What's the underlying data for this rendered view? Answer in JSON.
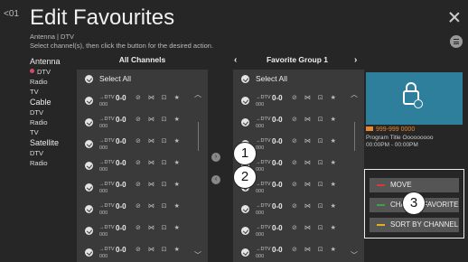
{
  "header": {
    "back_label": "<01",
    "title": "Edit Favourites",
    "breadcrumb": "Antenna | DTV",
    "instruction": "Select channel(s), then click the button for the desired action."
  },
  "sidebar": {
    "groups": [
      {
        "label": "Antenna",
        "items": [
          "DTV",
          "Radio",
          "TV"
        ]
      },
      {
        "label": "Cable",
        "items": [
          "DTV",
          "Radio",
          "TV"
        ]
      },
      {
        "label": "Satellite",
        "items": [
          "DTV",
          "Radio"
        ]
      }
    ]
  },
  "all_channels": {
    "header": "All Channels",
    "select_all": "Select All",
    "rows": [
      {
        "type": "DTV",
        "number": "0-0",
        "name": "000"
      },
      {
        "type": "DTV",
        "number": "0-0",
        "name": "000"
      },
      {
        "type": "DTV",
        "number": "0-0",
        "name": "000"
      },
      {
        "type": "DTV",
        "number": "0-0",
        "name": "000"
      },
      {
        "type": "DTV",
        "number": "0-0",
        "name": "000"
      },
      {
        "type": "DTV",
        "number": "0-0",
        "name": "000"
      },
      {
        "type": "DTV",
        "number": "0-0",
        "name": "000"
      },
      {
        "type": "DTV",
        "number": "0-0",
        "name": "000"
      }
    ]
  },
  "favorite_group": {
    "header": "Favorite Group 1",
    "prev_arrow": "‹",
    "next_arrow": "›",
    "select_all": "Select All",
    "rows": [
      {
        "type": "DTV",
        "number": "0-0",
        "name": "000"
      },
      {
        "type": "DTV",
        "number": "0-0",
        "name": "000"
      },
      {
        "type": "DTV",
        "number": "0-0",
        "name": "000"
      },
      {
        "type": "DTV",
        "number": "0-0",
        "name": "000"
      },
      {
        "type": "DTV",
        "number": "0-0",
        "name": "000"
      },
      {
        "type": "DTV",
        "number": "0-0",
        "name": "000"
      },
      {
        "type": "DTV",
        "number": "0-0",
        "name": "000"
      },
      {
        "type": "DTV",
        "number": "0-0",
        "name": "000"
      }
    ]
  },
  "transfer": {
    "add_label": "›",
    "remove_label": "‹"
  },
  "callouts": [
    "1",
    "2",
    "3"
  ],
  "preview": {
    "channel": "999-999 0000",
    "program_title": "Program Title Ooooooooo",
    "time": "00:00PM - 00:00PM"
  },
  "actions": [
    {
      "label": "MOVE",
      "color": "#d83a3a"
    },
    {
      "label": "CHANGE FAVORITE...",
      "color": "#3fa14a"
    },
    {
      "label": "SORT BY CHANNEL",
      "color": "#e0b31c"
    }
  ],
  "colors": {
    "accent": "#d04a6b",
    "preview_bg": "#2e7f9b",
    "program_orange": "#e8872d"
  }
}
